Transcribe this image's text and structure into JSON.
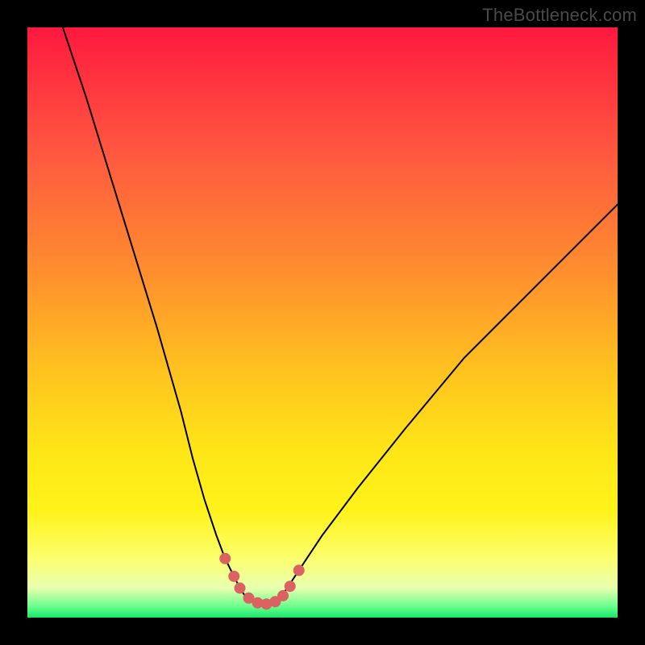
{
  "attribution": "TheBottleneck.com",
  "chart_data": {
    "type": "line",
    "title": "",
    "xlabel": "",
    "ylabel": "",
    "xlim": [
      0,
      100
    ],
    "ylim": [
      0,
      100
    ],
    "grid": false,
    "legend": false,
    "series": [
      {
        "name": "bottleneck-curve",
        "x": [
          6,
          10,
          14,
          18,
          22,
          26,
          28,
          30,
          32,
          33.5,
          35,
          36,
          37,
          38,
          39,
          40,
          41,
          42,
          43,
          44,
          46,
          50,
          56,
          64,
          74,
          86,
          100
        ],
        "y": [
          100,
          88,
          75,
          62,
          49,
          35,
          27,
          20,
          14,
          10,
          7,
          5,
          3.5,
          2.7,
          2.3,
          2.2,
          2.3,
          2.7,
          3.5,
          5,
          8,
          14,
          22,
          32,
          44,
          56,
          70
        ],
        "stroke": "#000000",
        "stroke_width": 2
      }
    ],
    "markers": {
      "name": "dip-dots",
      "color": "#da6261",
      "radius_px": 7,
      "points": [
        {
          "x": 33.5,
          "y": 10
        },
        {
          "x": 35,
          "y": 7
        },
        {
          "x": 36,
          "y": 5
        },
        {
          "x": 37.5,
          "y": 3.3
        },
        {
          "x": 39,
          "y": 2.5
        },
        {
          "x": 40.5,
          "y": 2.3
        },
        {
          "x": 42,
          "y": 2.7
        },
        {
          "x": 43.3,
          "y": 3.7
        },
        {
          "x": 44.5,
          "y": 5.3
        },
        {
          "x": 46,
          "y": 8
        }
      ]
    }
  }
}
